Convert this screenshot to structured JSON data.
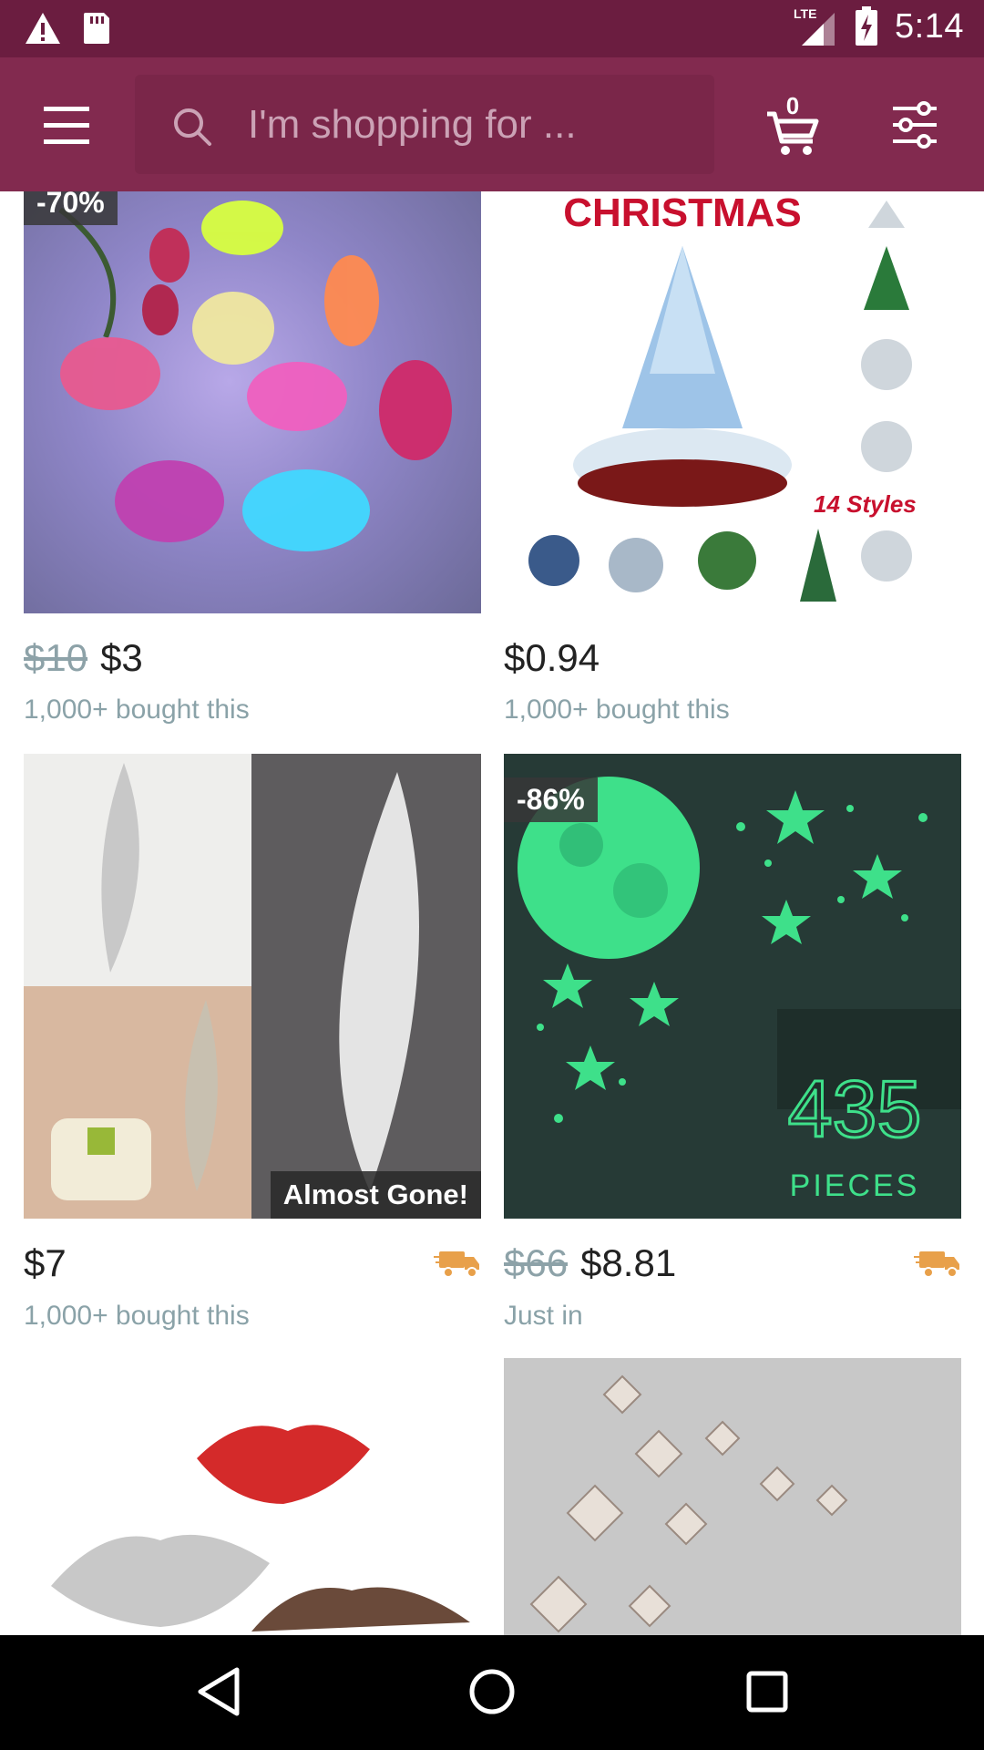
{
  "status_bar": {
    "time": "5:14",
    "network": "LTE",
    "icons": [
      "alert-icon",
      "sd-card-icon",
      "signal-icon",
      "battery-charging-icon"
    ]
  },
  "app_bar": {
    "menu_icon": "hamburger-menu-icon",
    "search_placeholder": "I'm shopping for ...",
    "cart_count": "0",
    "filter_icon": "filter-sliders-icon"
  },
  "products": [
    {
      "discount": "-70%",
      "old_price": "$10",
      "price": "$3",
      "meta": "1,000+ bought this",
      "image": "glowing-butterfly-lights"
    },
    {
      "discount": "",
      "old_price": "",
      "price": "$0.94",
      "meta": "1,000+ bought this",
      "image": "christmas-tree-ornament",
      "image_text": [
        "CHRISTMAS",
        "14 Styles"
      ]
    },
    {
      "discount": "",
      "old_price": "",
      "price": "$7",
      "meta": "1,000+ bought this",
      "badge": "Almost Gone!",
      "image": "feather-mirror-stickers",
      "shipping": true
    },
    {
      "discount": "-86%",
      "old_price": "$66",
      "price": "$8.81",
      "meta": "Just in",
      "image": "glow-moon-stars",
      "image_text": [
        "435",
        "PIECES"
      ],
      "shipping": true
    },
    {
      "image": "lip-mirror-stickers"
    },
    {
      "image": "mirror-butterfly-stickers"
    }
  ],
  "nav_bar": {
    "icons": [
      "back-icon",
      "home-icon",
      "recents-icon"
    ]
  },
  "colors": {
    "status_bar": "#6b1d40",
    "app_bar": "#822a4f",
    "search_box": "#7a2649",
    "shipping_icon": "#e8a04a",
    "meta_text": "#8aa2a8"
  }
}
